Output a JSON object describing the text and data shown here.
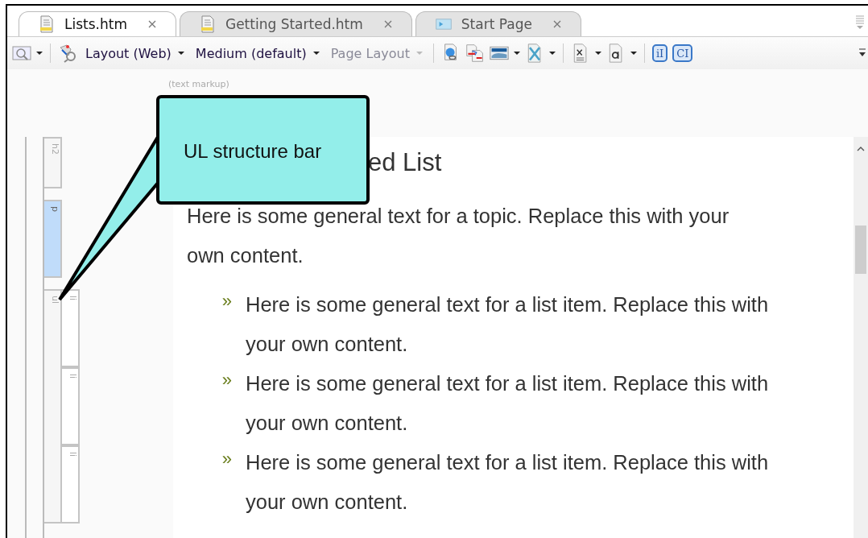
{
  "tabs": [
    {
      "label": "Lists.htm",
      "selected": true,
      "kind": "doc"
    },
    {
      "label": "Getting Started.htm",
      "selected": false,
      "kind": "doc"
    },
    {
      "label": "Start Page",
      "selected": false,
      "kind": "start"
    }
  ],
  "toolbar": {
    "dropdowns": [
      {
        "label": "Layout (Web)",
        "disabled": false
      },
      {
        "label": "Medium (default)",
        "disabled": false
      },
      {
        "label": "Page Layout",
        "disabled": true
      }
    ],
    "tag_buttons": [
      "iI",
      "CI"
    ]
  },
  "markup_label": "(text markup)",
  "structure_bar": [
    {
      "tag": "h2",
      "selected": false
    },
    {
      "tag": "p",
      "selected": true
    },
    {
      "tag": "ul",
      "selected": false,
      "children": [
        {
          "tag": "li",
          "selected": false
        },
        {
          "tag": "li",
          "selected": false
        },
        {
          "tag": "li",
          "selected": false
        }
      ]
    }
  ],
  "document": {
    "heading": "ed List",
    "paragraph": "Here is some general text for a topic. Replace this with your own content.",
    "list_items": [
      {
        "bullet": "»",
        "text": "Here is some general text for a list item. Replace this with your own content."
      },
      {
        "bullet": "»",
        "text": "Here is some general text for a list item. Replace this with your own content."
      },
      {
        "bullet": "»",
        "text": "Here is some general text for a list item. Replace this with your own content."
      }
    ]
  },
  "callout": {
    "text": "UL structure bar"
  }
}
